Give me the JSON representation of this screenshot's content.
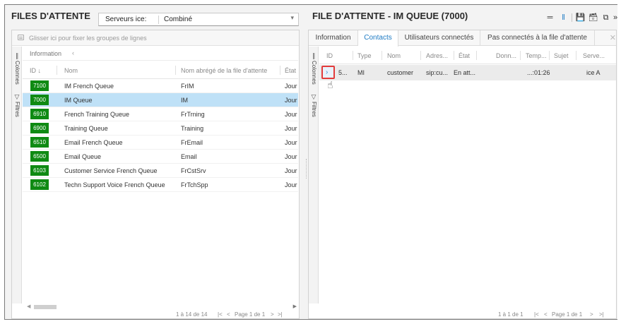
{
  "left": {
    "title": "FILES D'ATTENTE",
    "server_label": "Serveurs ice:",
    "server_value": "Combiné",
    "grouping_hint": "Glisser ici pour fixer les groupes de lignes",
    "vtabs": {
      "columns": "Colonnes",
      "filters": "Filtres"
    },
    "group_label": "Information",
    "columns": {
      "id": "ID",
      "name": "Nom",
      "short": "Nom abrégé de la file d'attente",
      "state": "État"
    },
    "rows": [
      {
        "id": "7100",
        "name": "IM French Queue",
        "short": "FrIM",
        "state": "Jour"
      },
      {
        "id": "7000",
        "name": "IM Queue",
        "short": "IM",
        "state": "Jour"
      },
      {
        "id": "6910",
        "name": "French Training Queue",
        "short": "FrTrning",
        "state": "Jour"
      },
      {
        "id": "6900",
        "name": "Training Queue",
        "short": "Training",
        "state": "Jour"
      },
      {
        "id": "6510",
        "name": "Email French Queue",
        "short": "FrEmail",
        "state": "Jour"
      },
      {
        "id": "6500",
        "name": "Email Queue",
        "short": "Email",
        "state": "Jour"
      },
      {
        "id": "6103",
        "name": "Customer Service French Queue",
        "short": "FrCstSrv",
        "state": "Jour"
      },
      {
        "id": "6102",
        "name": "Techn Support Voice French Queue",
        "short": "FrTchSpp",
        "state": "Jour"
      }
    ],
    "pager": {
      "range": "1 à 14 de 14",
      "first": "|<",
      "prev": "<",
      "page": "Page 1 de 1",
      "next": ">",
      "last": ">|"
    }
  },
  "right": {
    "title": "FILE D'ATTENTE - IM QUEUE (7000)",
    "tabs": [
      "Information",
      "Contacts",
      "Utilisateurs connectés",
      "Pas connectés à la file d'attente"
    ],
    "active_tab": "Contacts",
    "vtabs": {
      "columns": "Colonnes",
      "filters": "Filtres"
    },
    "columns": [
      "ID",
      "Type",
      "Nom",
      "Adres...",
      "État",
      "Donn...",
      "Temp...",
      "Sujet",
      "Serve..."
    ],
    "row": {
      "id": "5...",
      "type": "MI",
      "name": "customer",
      "address": "sip:cu...",
      "state": "En att...",
      "data": "",
      "time": "...:01:26",
      "subject": "",
      "server": "ice A"
    },
    "pager": {
      "range": "1 à 1 de 1",
      "first": "|<",
      "prev": "<",
      "page": "Page 1 de 1",
      "next": ">",
      "last": ">|"
    }
  },
  "colors": {
    "badge_green": "#0f8a13",
    "selected_row": "#bfe1f7",
    "accent_blue": "#1e7bc4",
    "highlight_red": "#e23b3b"
  }
}
